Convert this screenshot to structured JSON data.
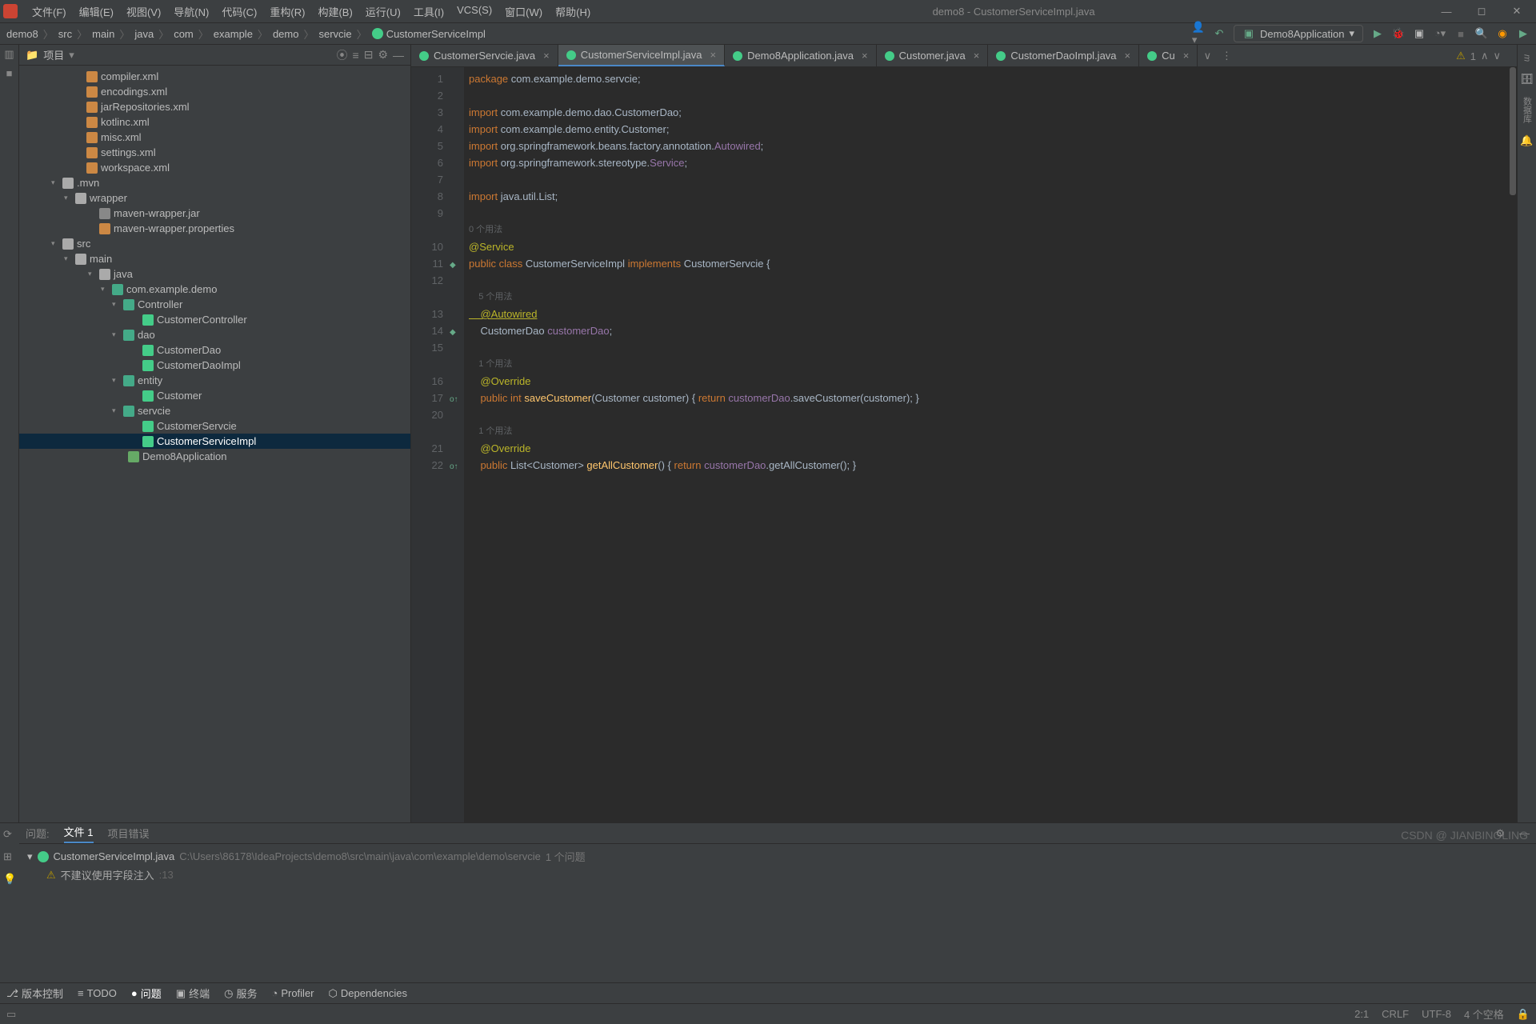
{
  "menu": {
    "items": [
      "文件(F)",
      "编辑(E)",
      "视图(V)",
      "导航(N)",
      "代码(C)",
      "重构(R)",
      "构建(B)",
      "运行(U)",
      "工具(I)",
      "VCS(S)",
      "窗口(W)",
      "帮助(H)"
    ],
    "title": "demo8 - CustomerServiceImpl.java"
  },
  "breadcrumbs": [
    "demo8",
    "src",
    "main",
    "java",
    "com",
    "example",
    "demo",
    "servcie",
    "CustomerServiceImpl"
  ],
  "runconfig": "Demo8Application",
  "project_label": "项目",
  "tree": [
    {
      "ind": 70,
      "icon": "xml",
      "label": "compiler.xml"
    },
    {
      "ind": 70,
      "icon": "xml",
      "label": "encodings.xml"
    },
    {
      "ind": 70,
      "icon": "xml",
      "label": "jarRepositories.xml"
    },
    {
      "ind": 70,
      "icon": "xml",
      "label": "kotlinc.xml"
    },
    {
      "ind": 70,
      "icon": "xml",
      "label": "misc.xml"
    },
    {
      "ind": 70,
      "icon": "xml",
      "label": "settings.xml"
    },
    {
      "ind": 70,
      "icon": "xml",
      "label": "workspace.xml"
    },
    {
      "ind": 40,
      "arrow": "▾",
      "icon": "folder",
      "label": ".mvn"
    },
    {
      "ind": 56,
      "arrow": "▾",
      "icon": "folder",
      "label": "wrapper"
    },
    {
      "ind": 86,
      "icon": "zip",
      "label": "maven-wrapper.jar"
    },
    {
      "ind": 86,
      "icon": "xml",
      "label": "maven-wrapper.properties"
    },
    {
      "ind": 40,
      "arrow": "▾",
      "icon": "folder",
      "label": "src"
    },
    {
      "ind": 56,
      "arrow": "▾",
      "icon": "folder",
      "label": "main"
    },
    {
      "ind": 86,
      "arrow": "▾",
      "icon": "folder",
      "label": "java"
    },
    {
      "ind": 102,
      "arrow": "▾",
      "icon": "pkg",
      "label": "com.example.demo"
    },
    {
      "ind": 116,
      "arrow": "▾",
      "icon": "pkg",
      "label": "Controller"
    },
    {
      "ind": 140,
      "icon": "java",
      "label": "CustomerController"
    },
    {
      "ind": 116,
      "arrow": "▾",
      "icon": "pkg",
      "label": "dao"
    },
    {
      "ind": 140,
      "icon": "java",
      "label": "CustomerDao"
    },
    {
      "ind": 140,
      "icon": "java",
      "label": "CustomerDaoImpl"
    },
    {
      "ind": 116,
      "arrow": "▾",
      "icon": "pkg",
      "label": "entity"
    },
    {
      "ind": 140,
      "icon": "java",
      "label": "Customer"
    },
    {
      "ind": 116,
      "arrow": "▾",
      "icon": "pkg",
      "label": "servcie"
    },
    {
      "ind": 140,
      "icon": "java",
      "label": "CustomerServcie"
    },
    {
      "ind": 140,
      "icon": "java",
      "label": "CustomerServiceImpl",
      "sel": true
    },
    {
      "ind": 122,
      "icon": "app",
      "label": "Demo8Application"
    }
  ],
  "tabs": [
    {
      "label": "CustomerServcie.java"
    },
    {
      "label": "CustomerServiceImpl.java",
      "active": true
    },
    {
      "label": "Demo8Application.java"
    },
    {
      "label": "Customer.java"
    },
    {
      "label": "CustomerDaoImpl.java"
    },
    {
      "label": "Cu"
    }
  ],
  "warnings": "1",
  "gutter": [
    "1",
    "2",
    "3",
    "4",
    "5",
    "6",
    "7",
    "8",
    "9",
    "",
    "10",
    "11",
    "12",
    "",
    "13",
    "14",
    "15",
    "",
    "16",
    "17",
    "20",
    "",
    "21",
    "22"
  ],
  "code": {
    "l1a": "package",
    "l1b": " com.example.demo.servcie;",
    "l3a": "import",
    "l3b": " com.example.demo.dao.CustomerDao;",
    "l4a": "import",
    "l4b": " com.example.demo.entity.Customer;",
    "l5a": "import",
    "l5b": " org.springframework.beans.factory.annotation.",
    "l5c": "Autowired",
    "l5d": ";",
    "l6a": "import",
    "l6b": " org.springframework.stereotype.",
    "l6c": "Service",
    "l6d": ";",
    "l8a": "import",
    "l8b": " java.util.List;",
    "u0": "0 个用法",
    "l10": "@Service",
    "l11a": "public class ",
    "l11b": "CustomerServiceImpl ",
    "l11c": "implements ",
    "l11d": "CustomerServcie {",
    "u5": "    5 个用法",
    "l13": "    @Autowired",
    "l14a": "    CustomerDao ",
    "l14b": "customerDao",
    "l14c": ";",
    "u1": "    1 个用法",
    "l16": "    @Override",
    "l17a": "    public int ",
    "l17b": "saveCustomer",
    "l17c": "(Customer customer) { ",
    "l17d": "return ",
    "l17e": "customerDao",
    "l17f": ".saveCustomer(customer); }",
    "l21": "    @Override",
    "l22a": "    public ",
    "l22b": "List<Customer> ",
    "l22c": "getAllCustomer",
    "l22d": "() { ",
    "l22e": "return ",
    "l22f": "customerDao",
    "l22g": ".getAllCustomer(); }"
  },
  "problems": {
    "header": "问题:",
    "tab1": "文件",
    "tab1_count": "1",
    "tab2": "项目错误",
    "file": "CustomerServiceImpl.java",
    "path": "C:\\Users\\86178\\IdeaProjects\\demo8\\src\\main\\java\\com\\example\\demo\\servcie",
    "count": "1 个问题",
    "msg": "不建议使用字段注入",
    "line": ":13"
  },
  "bottom": [
    {
      "icon": "⎇",
      "label": "版本控制"
    },
    {
      "icon": "≡",
      "label": "TODO"
    },
    {
      "icon": "●",
      "label": "问题",
      "active": true
    },
    {
      "icon": "▣",
      "label": "终端"
    },
    {
      "icon": "◷",
      "label": "服务"
    },
    {
      "icon": "◔",
      "label": "Profiler"
    },
    {
      "icon": "⬡",
      "label": "Dependencies"
    }
  ],
  "status": {
    "caret": "2:1",
    "enc": "CRLF",
    "charset": "UTF-8",
    "indent": "4 个空格"
  },
  "watermark": "CSDN @ JIANBINOLING"
}
